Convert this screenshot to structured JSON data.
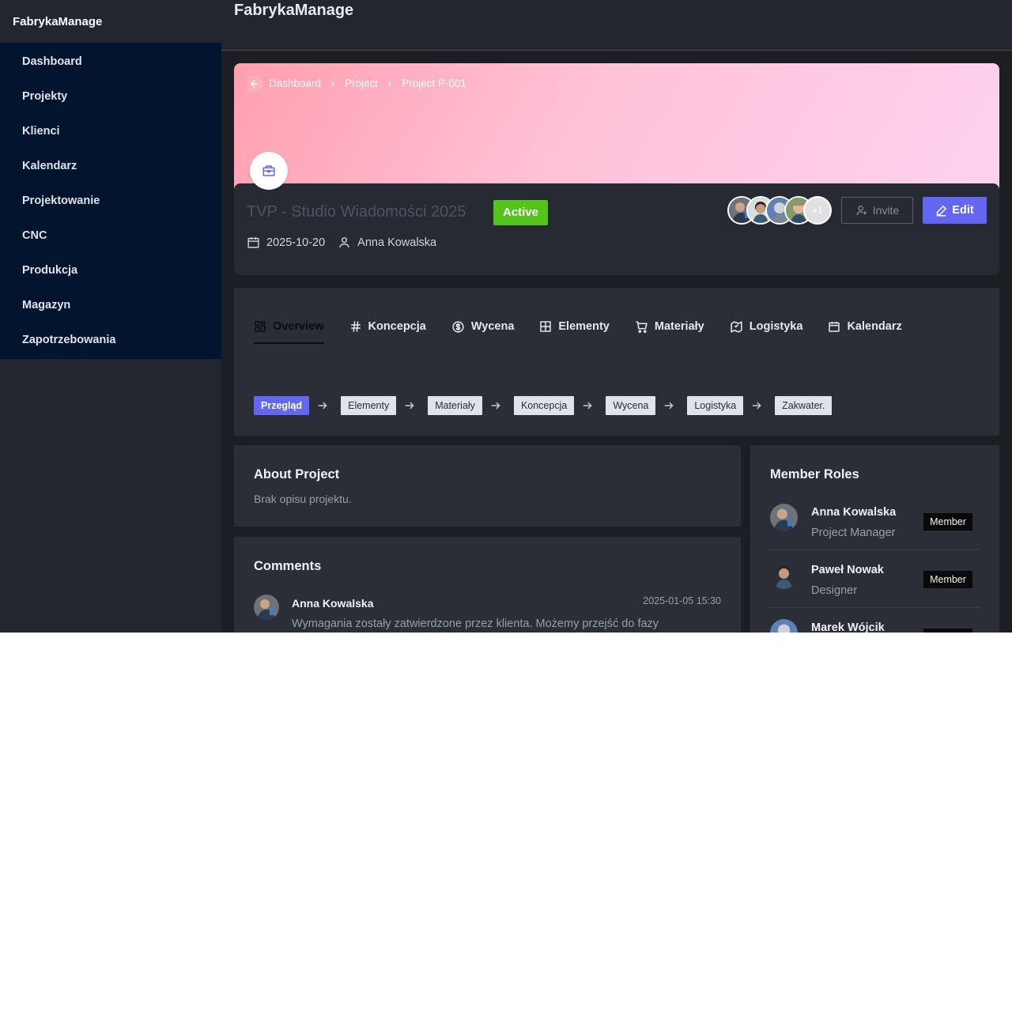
{
  "app": {
    "brand": "FabrykaManage",
    "topbar_title": "FabrykaManage"
  },
  "sidebar": {
    "items": [
      {
        "label": "Dashboard"
      },
      {
        "label": "Projekty"
      },
      {
        "label": "Klienci"
      },
      {
        "label": "Kalendarz"
      },
      {
        "label": "Projektowanie"
      },
      {
        "label": "CNC"
      },
      {
        "label": "Produkcja"
      },
      {
        "label": "Magazyn"
      },
      {
        "label": "Zapotrzebowania"
      }
    ]
  },
  "breadcrumb": {
    "items": [
      "Dashboard",
      "Project",
      "Project P-001"
    ]
  },
  "project": {
    "title": "TVP - Studio Wiadomości 2025",
    "status": "Active",
    "date": "2025-10-20",
    "manager": "Anna Kowalska",
    "extra_members": "+1",
    "invite_label": "Invite",
    "edit_label": "Edit"
  },
  "tabs": [
    {
      "label": "Overview",
      "icon": "overview-icon"
    },
    {
      "label": "Koncepcja",
      "icon": "hash-icon"
    },
    {
      "label": "Wycena",
      "icon": "dollar-circle-icon"
    },
    {
      "label": "Elementy",
      "icon": "grid-icon"
    },
    {
      "label": "Materiały",
      "icon": "cart-icon"
    },
    {
      "label": "Logistyka",
      "icon": "map-pin-icon"
    },
    {
      "label": "Kalendarz",
      "icon": "calendar-icon"
    }
  ],
  "flow": [
    "Przegląd",
    "Elementy",
    "Materiały",
    "Koncepcja",
    "Wycena",
    "Logistyka",
    "Zakwater."
  ],
  "about": {
    "title": "About Project",
    "text": "Brak opisu projektu."
  },
  "comments": {
    "title": "Comments",
    "items": [
      {
        "author": "Anna Kowalska",
        "time": "2025-01-05 15:30",
        "text": "Wymagania zostały zatwierdzone przez klienta. Możemy przejść do fazy"
      }
    ]
  },
  "members": {
    "title": "Member Roles",
    "items": [
      {
        "name": "Anna Kowalska",
        "role": "Project Manager",
        "badge": "Member"
      },
      {
        "name": "Paweł Nowak",
        "role": "Designer",
        "badge": "Member"
      },
      {
        "name": "Marek Wójcik",
        "role": "",
        "badge": ""
      }
    ]
  },
  "colors": {
    "accent": "#6366f1",
    "active": "#52c41a",
    "sidebar": "#03152e",
    "background": "#23262f"
  }
}
